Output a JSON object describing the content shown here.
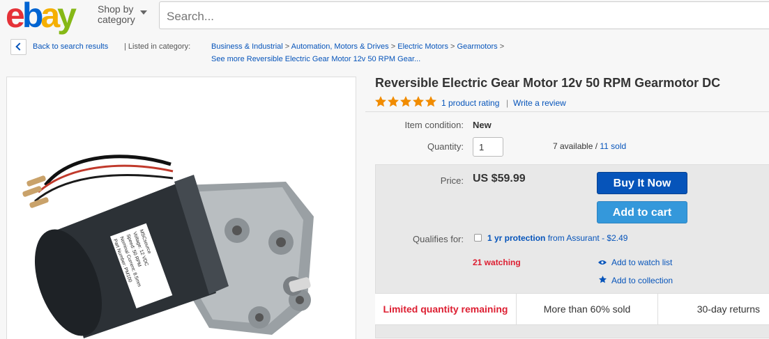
{
  "header": {
    "logo": {
      "letters": [
        "e",
        "b",
        "a",
        "y"
      ],
      "colors": [
        "#e53238",
        "#0064d2",
        "#f5af02",
        "#86b817"
      ]
    },
    "shop_by": {
      "line1": "Shop by",
      "line2": "category"
    },
    "search": {
      "placeholder": "Search..."
    }
  },
  "breadcrumb": {
    "back": "Back to search results",
    "separator": "|",
    "listed_label": "Listed in category:",
    "items": [
      "Business & Industrial",
      "Automation, Motors & Drives",
      "Electric Motors",
      "Gearmotors"
    ],
    "arrow": ">",
    "see_more": "See more Reversible Electric Gear Motor 12v 50 RPM Gear..."
  },
  "product": {
    "title": "Reversible Electric Gear Motor 12v 50 RPM Gearmotor DC",
    "rating": {
      "stars": 5,
      "star_color": "#f18c00",
      "count_text": "1 product rating",
      "separator": "|",
      "write_review": "Write a review"
    },
    "condition": {
      "label": "Item condition:",
      "value": "New"
    },
    "quantity": {
      "label": "Quantity:",
      "value": "1",
      "available": "7 available /",
      "sold": "11 sold"
    },
    "price": {
      "label": "Price:",
      "value": "US $59.99"
    },
    "buttons": {
      "buy_now": "Buy It Now",
      "add_to_cart": "Add to cart"
    },
    "protection": {
      "label": "Qualifies for:",
      "plan": "1 yr protection",
      "rest": "from Assurant - $2.49"
    },
    "watching": "21 watching",
    "actions": [
      {
        "icon": "eye-icon",
        "label": "Add to watch list"
      },
      {
        "icon": "star-icon",
        "label": "Add to collection"
      }
    ],
    "promos": [
      "Limited quantity remaining",
      "More than 60% sold",
      "30-day returns"
    ],
    "image_label": {
      "brand": "MSCsource",
      "lines": [
        "Voltage: 12 VDC",
        "Speed: 50 RPM",
        "Nominal Current: 8.5mm",
        "Part Number: PM100"
      ]
    }
  }
}
